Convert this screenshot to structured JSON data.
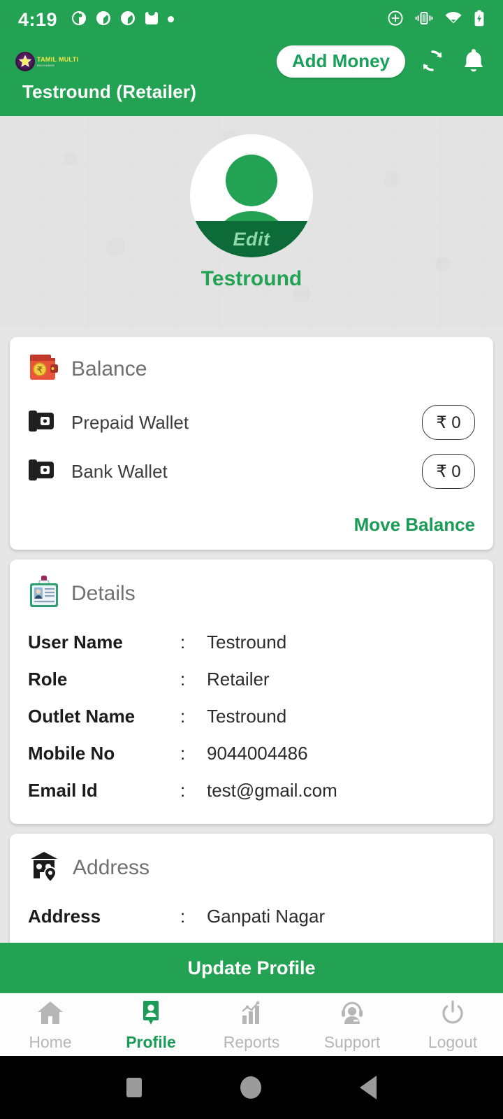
{
  "status_bar": {
    "time": "4:19",
    "left_icons": [
      "notification-dot-icon",
      "clock-icon",
      "clock-icon-2",
      "inbox-icon",
      "dot-icon"
    ],
    "right_icons": [
      "add-circle-icon",
      "vibrate-icon",
      "wifi-icon",
      "battery-charging-icon"
    ]
  },
  "app_bar": {
    "logo_line1": "TAMIL MULTI",
    "logo_line2": "RECHARGE",
    "add_money_label": "Add Money",
    "refresh_icon": "refresh-icon",
    "notification_icon": "bell-icon",
    "title": "Testround (Retailer)"
  },
  "hero": {
    "edit_label": "Edit",
    "name": "Testround"
  },
  "balance_card": {
    "title": "Balance",
    "icon": "wallet-rupee-icon",
    "rows": [
      {
        "label": "Prepaid Wallet",
        "icon": "wallet-icon",
        "amount": "₹ 0"
      },
      {
        "label": "Bank Wallet",
        "icon": "wallet-icon",
        "amount": "₹ 0"
      }
    ],
    "move_balance_label": "Move Balance"
  },
  "details_card": {
    "title": "Details",
    "icon": "id-badge-icon",
    "separator": ":",
    "rows": [
      {
        "label": "User Name",
        "value": "Testround"
      },
      {
        "label": "Role",
        "value": "Retailer"
      },
      {
        "label": "Outlet Name",
        "value": "Testround"
      },
      {
        "label": "Mobile No",
        "value": "9044004486"
      },
      {
        "label": "Email Id",
        "value": "test@gmail.com"
      }
    ]
  },
  "address_card": {
    "title": "Address",
    "icon": "house-location-icon",
    "rows": [
      {
        "label": "Address",
        "value": "Ganpati Nagar"
      }
    ]
  },
  "update_profile_label": "Update Profile",
  "bottom_nav": {
    "items": [
      {
        "label": "Home",
        "icon": "home-icon",
        "active": false
      },
      {
        "label": "Profile",
        "icon": "profile-pin-icon",
        "active": true
      },
      {
        "label": "Reports",
        "icon": "bar-chart-icon",
        "active": false
      },
      {
        "label": "Support",
        "icon": "headset-icon",
        "active": false
      },
      {
        "label": "Logout",
        "icon": "power-icon",
        "active": false
      }
    ]
  },
  "system_nav": {
    "recents": "square-icon",
    "home": "circle-icon",
    "back": "triangle-back-icon"
  },
  "colors": {
    "brand_green": "#22a252",
    "accent_green": "#1a9b56",
    "edit_band": "#0c6b38",
    "page_bg": "#e6e6e6",
    "hero_bg": "#e3e3e3",
    "nav_inactive": "#b6b6b6"
  }
}
